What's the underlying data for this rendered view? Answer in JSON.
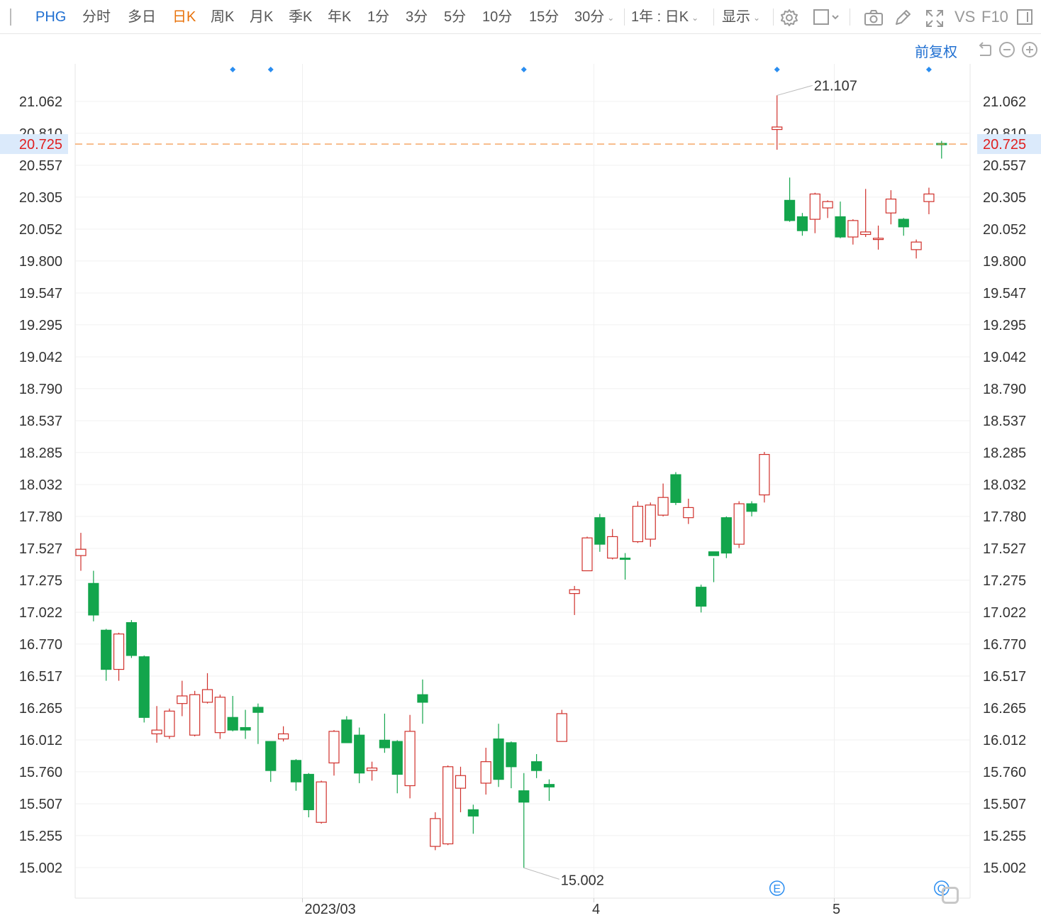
{
  "toolbar": {
    "symbol": "PHG",
    "periods": [
      "分时",
      "多日",
      "日K",
      "周K",
      "月K",
      "季K",
      "年K",
      "1分",
      "3分",
      "5分",
      "10分",
      "15分",
      "30分"
    ],
    "active_period": "日K",
    "range": "1年 : 日K",
    "display": "显示",
    "vs": "VS",
    "f10": "F10",
    "adjust": "前复权"
  },
  "colors": {
    "up": "#d0302b",
    "down": "#13a54c",
    "accent": "#1f6fd1",
    "active": "#e8730c",
    "price_line": "#f28a35",
    "price_label": "#e02020"
  },
  "chart_data": {
    "type": "candlestick",
    "symbol": "PHG",
    "y_ticks": [
      "21.062",
      "20.810",
      "20.557",
      "20.305",
      "20.052",
      "19.800",
      "19.547",
      "19.295",
      "19.042",
      "18.790",
      "18.537",
      "18.285",
      "18.032",
      "17.780",
      "17.527",
      "17.275",
      "17.022",
      "16.770",
      "16.517",
      "16.265",
      "16.012",
      "15.760",
      "15.507",
      "15.255",
      "15.002"
    ],
    "ylim": [
      14.8,
      21.52
    ],
    "x_labels": [
      {
        "label": "2023/03",
        "index": 18
      },
      {
        "label": "4",
        "index": 41
      },
      {
        "label": "5",
        "index": 60
      }
    ],
    "current_price": "20.725",
    "high_label": "21.107",
    "low_label": "15.002",
    "event_markers": [
      12,
      15,
      35,
      55,
      67
    ],
    "event_badges": [
      {
        "letter": "E",
        "index": 55
      },
      {
        "letter": "Q",
        "index": 68
      }
    ],
    "grid": true,
    "candles": [
      {
        "o": 17.47,
        "h": 17.65,
        "l": 17.35,
        "c": 17.52
      },
      {
        "o": 17.25,
        "h": 17.35,
        "l": 16.95,
        "c": 17.0
      },
      {
        "o": 16.88,
        "h": 16.89,
        "l": 16.48,
        "c": 16.57
      },
      {
        "o": 16.57,
        "h": 16.86,
        "l": 16.48,
        "c": 16.85
      },
      {
        "o": 16.94,
        "h": 16.96,
        "l": 16.66,
        "c": 16.68
      },
      {
        "o": 16.67,
        "h": 16.68,
        "l": 16.15,
        "c": 16.19
      },
      {
        "o": 16.06,
        "h": 16.28,
        "l": 15.99,
        "c": 16.09
      },
      {
        "o": 16.04,
        "h": 16.26,
        "l": 16.02,
        "c": 16.24
      },
      {
        "o": 16.3,
        "h": 16.48,
        "l": 16.2,
        "c": 16.36
      },
      {
        "o": 16.05,
        "h": 16.4,
        "l": 16.04,
        "c": 16.37
      },
      {
        "o": 16.31,
        "h": 16.54,
        "l": 16.3,
        "c": 16.41
      },
      {
        "o": 16.07,
        "h": 16.37,
        "l": 16.02,
        "c": 16.35
      },
      {
        "o": 16.19,
        "h": 16.36,
        "l": 16.08,
        "c": 16.09
      },
      {
        "o": 16.11,
        "h": 16.25,
        "l": 16.02,
        "c": 16.09
      },
      {
        "o": 16.27,
        "h": 16.3,
        "l": 15.98,
        "c": 16.23
      },
      {
        "o": 16.0,
        "h": 16.0,
        "l": 15.68,
        "c": 15.77
      },
      {
        "o": 16.02,
        "h": 16.12,
        "l": 16.0,
        "c": 16.06
      },
      {
        "o": 15.85,
        "h": 15.86,
        "l": 15.61,
        "c": 15.68
      },
      {
        "o": 15.74,
        "h": 15.75,
        "l": 15.4,
        "c": 15.46
      },
      {
        "o": 15.36,
        "h": 15.69,
        "l": 15.35,
        "c": 15.68
      },
      {
        "o": 15.83,
        "h": 16.09,
        "l": 15.73,
        "c": 16.08
      },
      {
        "o": 16.17,
        "h": 16.2,
        "l": 15.99,
        "c": 15.99
      },
      {
        "o": 16.05,
        "h": 16.11,
        "l": 15.67,
        "c": 15.75
      },
      {
        "o": 15.77,
        "h": 15.84,
        "l": 15.69,
        "c": 15.79
      },
      {
        "o": 16.01,
        "h": 16.22,
        "l": 15.91,
        "c": 15.95
      },
      {
        "o": 16.0,
        "h": 16.01,
        "l": 15.59,
        "c": 15.74
      },
      {
        "o": 15.65,
        "h": 16.21,
        "l": 15.55,
        "c": 16.08
      },
      {
        "o": 16.37,
        "h": 16.49,
        "l": 16.14,
        "c": 16.31
      },
      {
        "o": 15.17,
        "h": 15.44,
        "l": 15.14,
        "c": 15.39
      },
      {
        "o": 15.19,
        "h": 15.81,
        "l": 15.18,
        "c": 15.8
      },
      {
        "o": 15.63,
        "h": 15.8,
        "l": 15.44,
        "c": 15.73
      },
      {
        "o": 15.46,
        "h": 15.5,
        "l": 15.27,
        "c": 15.41
      },
      {
        "o": 15.67,
        "h": 15.95,
        "l": 15.58,
        "c": 15.84
      },
      {
        "o": 16.02,
        "h": 16.14,
        "l": 15.64,
        "c": 15.7
      },
      {
        "o": 15.99,
        "h": 16.0,
        "l": 15.63,
        "c": 15.8
      },
      {
        "o": 15.61,
        "h": 15.75,
        "l": 15.0,
        "c": 15.52
      },
      {
        "o": 15.84,
        "h": 15.9,
        "l": 15.71,
        "c": 15.77
      },
      {
        "o": 15.66,
        "h": 15.7,
        "l": 15.53,
        "c": 15.64
      },
      {
        "o": 16.0,
        "h": 16.25,
        "l": 16.0,
        "c": 16.22
      },
      {
        "o": 17.17,
        "h": 17.23,
        "l": 17.0,
        "c": 17.2
      },
      {
        "o": 17.35,
        "h": 17.62,
        "l": 17.35,
        "c": 17.61
      },
      {
        "o": 17.77,
        "h": 17.8,
        "l": 17.5,
        "c": 17.56
      },
      {
        "o": 17.45,
        "h": 17.68,
        "l": 17.44,
        "c": 17.62
      },
      {
        "o": 17.45,
        "h": 17.49,
        "l": 17.28,
        "c": 17.44
      },
      {
        "o": 17.58,
        "h": 17.9,
        "l": 17.57,
        "c": 17.86
      },
      {
        "o": 17.6,
        "h": 17.89,
        "l": 17.54,
        "c": 17.87
      },
      {
        "o": 17.79,
        "h": 18.04,
        "l": 17.78,
        "c": 17.93
      },
      {
        "o": 18.11,
        "h": 18.13,
        "l": 17.87,
        "c": 17.89
      },
      {
        "o": 17.77,
        "h": 17.92,
        "l": 17.72,
        "c": 17.85
      },
      {
        "o": 17.22,
        "h": 17.24,
        "l": 17.02,
        "c": 17.07
      },
      {
        "o": 17.5,
        "h": 17.45,
        "l": 17.26,
        "c": 17.47
      },
      {
        "o": 17.77,
        "h": 17.78,
        "l": 17.45,
        "c": 17.49
      },
      {
        "o": 17.56,
        "h": 17.9,
        "l": 17.53,
        "c": 17.88
      },
      {
        "o": 17.88,
        "h": 17.9,
        "l": 17.78,
        "c": 17.82
      },
      {
        "o": 17.95,
        "h": 18.29,
        "l": 17.89,
        "c": 18.27
      },
      {
        "o": 20.84,
        "h": 21.11,
        "l": 20.68,
        "c": 20.86
      },
      {
        "o": 20.28,
        "h": 20.46,
        "l": 20.11,
        "c": 20.12
      },
      {
        "o": 20.15,
        "h": 20.18,
        "l": 20.0,
        "c": 20.04
      },
      {
        "o": 20.13,
        "h": 20.34,
        "l": 20.02,
        "c": 20.33
      },
      {
        "o": 20.22,
        "h": 20.28,
        "l": 20.14,
        "c": 20.27
      },
      {
        "o": 20.15,
        "h": 20.27,
        "l": 19.98,
        "c": 19.99
      },
      {
        "o": 19.99,
        "h": 20.13,
        "l": 19.93,
        "c": 20.12
      },
      {
        "o": 20.01,
        "h": 20.37,
        "l": 19.99,
        "c": 20.03
      },
      {
        "o": 19.97,
        "h": 20.08,
        "l": 19.89,
        "c": 19.98
      },
      {
        "o": 20.18,
        "h": 20.36,
        "l": 20.09,
        "c": 20.29
      },
      {
        "o": 20.13,
        "h": 20.14,
        "l": 20.0,
        "c": 20.07
      },
      {
        "o": 19.89,
        "h": 19.97,
        "l": 19.82,
        "c": 19.95
      },
      {
        "o": 20.27,
        "h": 20.38,
        "l": 20.17,
        "c": 20.33
      },
      {
        "o": 20.73,
        "h": 20.75,
        "l": 20.61,
        "c": 20.72
      }
    ]
  }
}
